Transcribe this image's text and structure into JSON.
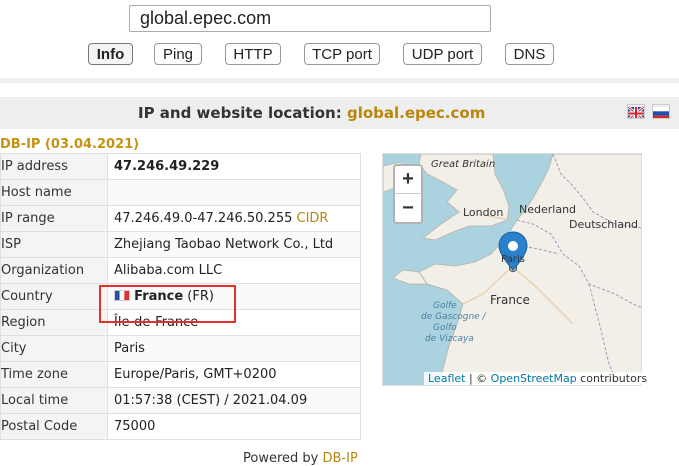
{
  "search": {
    "value": "global.epec.com"
  },
  "toolbar": {
    "buttons": [
      {
        "label": "Info"
      },
      {
        "label": "Ping"
      },
      {
        "label": "HTTP"
      },
      {
        "label": "TCP port"
      },
      {
        "label": "UDP port"
      },
      {
        "label": "DNS"
      }
    ]
  },
  "header": {
    "title_prefix": "IP and website location:",
    "host": "global.epec.com"
  },
  "db_label": "DB-IP (03.04.2021)",
  "info": {
    "ip_address": {
      "key": "IP address",
      "value": "47.246.49.229"
    },
    "host_name": {
      "key": "Host name",
      "value": ""
    },
    "ip_range": {
      "key": "IP range",
      "value": "47.246.49.0-47.246.50.255",
      "link": "CIDR"
    },
    "isp": {
      "key": "ISP",
      "value": "Zhejiang Taobao Network Co., Ltd"
    },
    "organization": {
      "key": "Organization",
      "value": "Alibaba.com LLC"
    },
    "country": {
      "key": "Country",
      "name": "France",
      "code": "(FR)"
    },
    "region": {
      "key": "Region",
      "value": "Île-de-France"
    },
    "city": {
      "key": "City",
      "value": "Paris"
    },
    "time_zone": {
      "key": "Time zone",
      "value": "Europe/Paris, GMT+0200"
    },
    "local_time": {
      "key": "Local time",
      "value": "01:57:38 (CEST) / 2021.04.09"
    },
    "postal_code": {
      "key": "Postal Code",
      "value": "75000"
    }
  },
  "powered": {
    "prefix": "Powered by",
    "link": "DB-IP"
  },
  "map": {
    "labels": {
      "great_britain": "Great Britain",
      "london": "London",
      "nederland": "Nederland",
      "deutschland": "Deutschland",
      "paris": "Paris",
      "france": "France",
      "golfe_gascogne": "Golfe",
      "golfe_gascogne_2": "de Gascogne /",
      "golfo_vizcaya": "Golfo",
      "golfo_vizcaya_2": "de Vizcaya"
    },
    "zoom_in": "+",
    "zoom_out": "−",
    "attribution": {
      "leaflet": "Leaflet",
      "sep": " | © ",
      "osm": "OpenStreetMap",
      "suffix": " contributors"
    }
  },
  "colors": {
    "accent": "#b8860b",
    "highlight": "#e03030",
    "sea": "#aad3df",
    "land": "#f2efe9"
  }
}
